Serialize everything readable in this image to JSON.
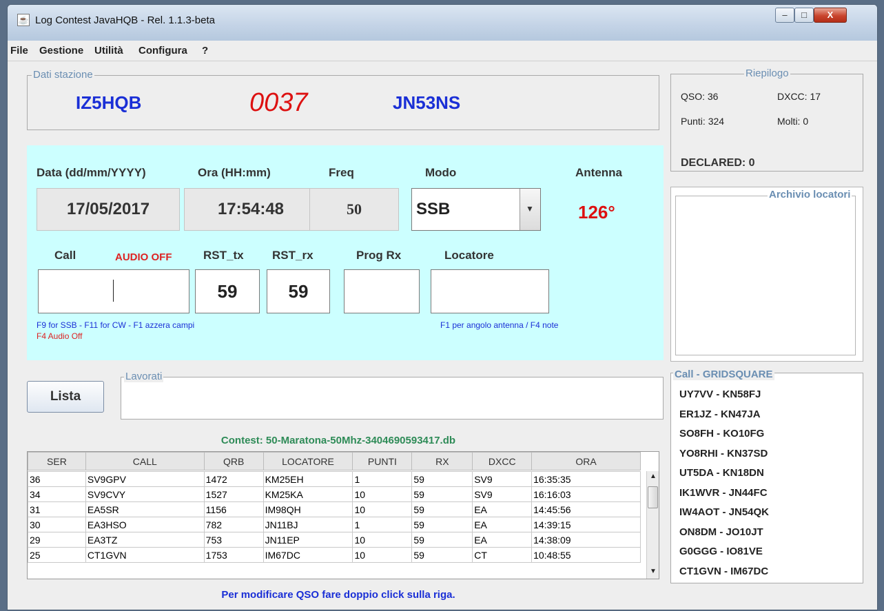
{
  "window": {
    "title": "Log Contest JavaHQB - Rel. 1.1.3-beta",
    "buttons": {
      "minimize": "–",
      "maximize": "□",
      "close": "X"
    }
  },
  "menu": [
    "File",
    "Gestione",
    "Utilità",
    "Configura",
    "?"
  ],
  "station": {
    "panel_title": "Dati stazione",
    "callsign": "IZ5HQB",
    "serial": "0037",
    "locator": "JN53NS"
  },
  "summary": {
    "panel_title": "Riepilogo",
    "qso": "QSO: 36",
    "dxcc": "DXCC:   17",
    "punti": "Punti: 324",
    "molti": "Molti: 0",
    "declared": "DECLARED: 0"
  },
  "entry": {
    "labels": {
      "date": "Data (dd/mm/YYYY)",
      "time": "Ora (HH:mm)",
      "freq": "Freq",
      "mode": "Modo",
      "antenna": "Antenna",
      "call": "Call",
      "audio": "AUDIO OFF",
      "rst_tx": "RST_tx",
      "rst_rx": "RST_rx",
      "prog_rx": "Prog Rx",
      "locator": "Locatore"
    },
    "values": {
      "date": "17/05/2017",
      "time": "17:54:48",
      "freq": "50",
      "mode": "SSB",
      "antenna": "126°",
      "call": "",
      "rst_tx": "59",
      "rst_rx": "59",
      "prog_rx": "",
      "locator": ""
    },
    "hints": {
      "left": "F9 for SSB - F11 for CW - F1 azzera campi",
      "audio": "F4 Audio Off",
      "right": "F1 per angolo antenna / F4 note"
    }
  },
  "archive": {
    "panel_title": "Archivio locatori"
  },
  "worked": {
    "panel_title": "Lavorati",
    "button": "Lista"
  },
  "contest": {
    "file": "Contest: 50-Maratona-50Mhz-3404690593417.db"
  },
  "log": {
    "headers": [
      "SER",
      "CALL",
      "QRB",
      "LOCATORE",
      "PUNTI",
      "RX",
      "DXCC",
      "ORA"
    ],
    "rows": [
      [
        "36",
        "SV9GPV",
        "1472",
        "KM25EH",
        "1",
        "59",
        "SV9",
        "16:35:35"
      ],
      [
        "34",
        "SV9CVY",
        "1527",
        "KM25KA",
        "10",
        "59",
        "SV9",
        "16:16:03"
      ],
      [
        "31",
        "EA5SR",
        "1156",
        "IM98QH",
        "10",
        "59",
        "EA",
        "14:45:56"
      ],
      [
        "30",
        "EA3HSO",
        "782",
        "JN11BJ",
        "1",
        "59",
        "EA",
        "14:39:15"
      ],
      [
        "29",
        "EA3TZ",
        "753",
        "JN11EP",
        "10",
        "59",
        "EA",
        "14:38:09"
      ],
      [
        "25",
        "CT1GVN",
        "1753",
        "IM67DC",
        "10",
        "59",
        "CT",
        "10:48:55"
      ]
    ],
    "footer": "Per modificare QSO fare doppio click sulla riga."
  },
  "grid": {
    "panel_title": "Call - GRIDSQUARE",
    "items": [
      "UY7VV - KN58FJ",
      "ER1JZ - KN47JA",
      "SO8FH - KO10FG",
      "YO8RHI - KN37SD",
      "UT5DA - KN18DN",
      "IK1WVR - JN44FC",
      "IW4AOT - JN54QK",
      "ON8DM - JO10JT",
      "G0GGG - IO81VE",
      "CT1GVN - IM67DC"
    ]
  },
  "colors": {
    "accent_blue": "#1a2fd6",
    "serial_red": "#dd1111",
    "entry_bg": "#ccffff",
    "contest_green": "#2e8b57"
  }
}
